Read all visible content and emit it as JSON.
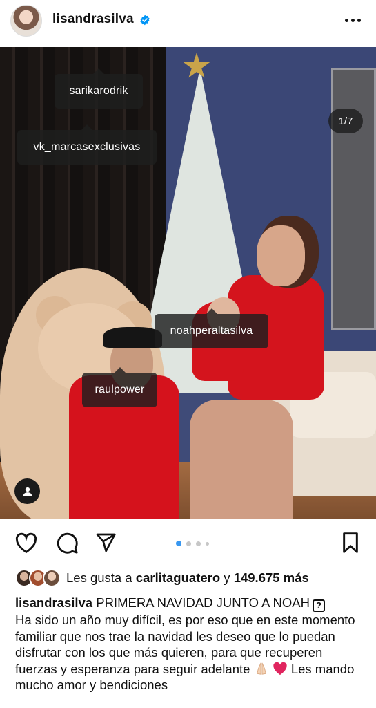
{
  "header": {
    "username": "lisandrasilva",
    "verified": true,
    "more_icon": "more-horizontal-icon"
  },
  "post": {
    "counter": "1/7",
    "tags": [
      "sarikarodrik",
      "vk_marcasexclusivas",
      "noahperaltasilva",
      "raulpower"
    ],
    "user_tag_icon": "user-icon"
  },
  "actions": {
    "like_icon": "heart-icon",
    "comment_icon": "comment-icon",
    "share_icon": "send-icon",
    "save_icon": "bookmark-icon",
    "carousel_dots": 4,
    "active_dot": 1
  },
  "likes": {
    "prefix": "Les gusta a",
    "user": "carlitaguatero",
    "connector": "y",
    "count": "149.675 más"
  },
  "caption": {
    "username": "lisandrasilva",
    "title": "PRIMERA NAVIDAD JUNTO A NOAH",
    "qbox": "?",
    "body1": "Ha sido un año muy difícil, es por eso que en este momento familiar que nos trae la navidad les deseo que lo puedan disfrutar con los que más quieren, para que recuperen fuerzas y esperanza para seguir adelante",
    "body2": "Les mando mucho amor y bendiciones"
  },
  "colors": {
    "accent": "#3897f0",
    "verified": "#0095f6",
    "heart": "#e0245e"
  }
}
